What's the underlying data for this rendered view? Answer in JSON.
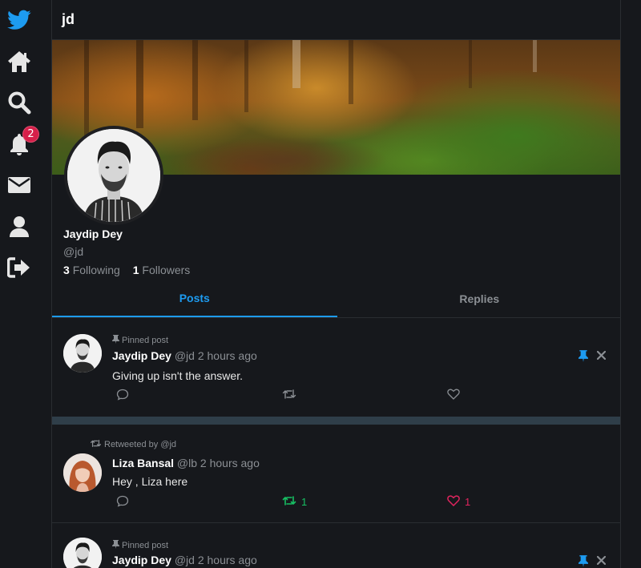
{
  "nav": {
    "logo": "bird-logo",
    "items": [
      "home-icon",
      "search-icon",
      "bell-icon",
      "mail-icon",
      "user-icon",
      "logout-icon"
    ],
    "notification_count": "2"
  },
  "header": {
    "title": "jd"
  },
  "profile": {
    "name": "Jaydip Dey",
    "handle": "@jd",
    "following_count": "3",
    "following_label": "Following",
    "followers_count": "1",
    "followers_label": "Followers"
  },
  "tabs": [
    {
      "label": "Posts",
      "active": true
    },
    {
      "label": "Replies",
      "active": false
    }
  ],
  "posts": [
    {
      "context": "Pinned post",
      "name": "Jaydip Dey",
      "handle": "@jd",
      "time": "2 hours ago",
      "text": "Giving up isn't the answer.",
      "retweets": "",
      "likes": ""
    },
    {
      "context": "Retweeted by @jd",
      "name": "Liza Bansal",
      "handle": "@lb",
      "time": "2 hours ago",
      "text": "Hey , Liza here",
      "retweets": "1",
      "likes": "1"
    },
    {
      "context": "Pinned post",
      "name": "Jaydip Dey",
      "handle": "@jd",
      "time": "2 hours ago"
    }
  ],
  "colors": {
    "accent": "#1d9bf0",
    "retweet": "#17bf63",
    "like": "#e0245e",
    "background": "#16181c"
  }
}
